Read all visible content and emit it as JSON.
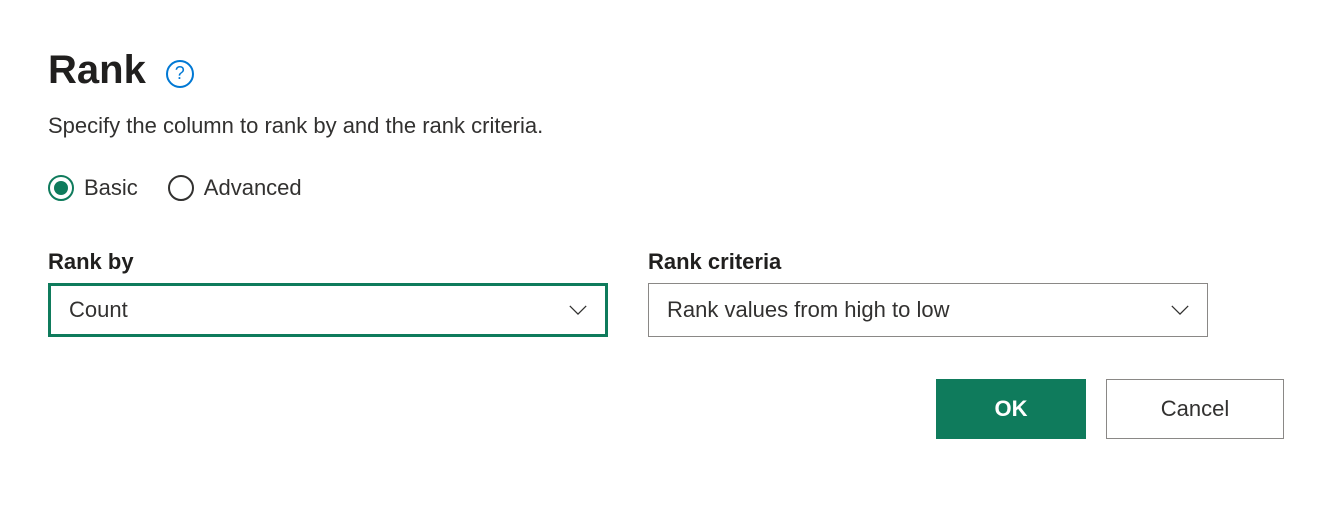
{
  "title": "Rank",
  "help_symbol": "?",
  "description": "Specify the column to rank by and the rank criteria.",
  "mode": {
    "basic_label": "Basic",
    "advanced_label": "Advanced",
    "selected": "basic"
  },
  "rank_by": {
    "label": "Rank by",
    "value": "Count"
  },
  "rank_criteria": {
    "label": "Rank criteria",
    "value": "Rank values from high to low"
  },
  "buttons": {
    "ok": "OK",
    "cancel": "Cancel"
  },
  "colors": {
    "accent": "#0f7b5c",
    "link": "#0078d4"
  }
}
